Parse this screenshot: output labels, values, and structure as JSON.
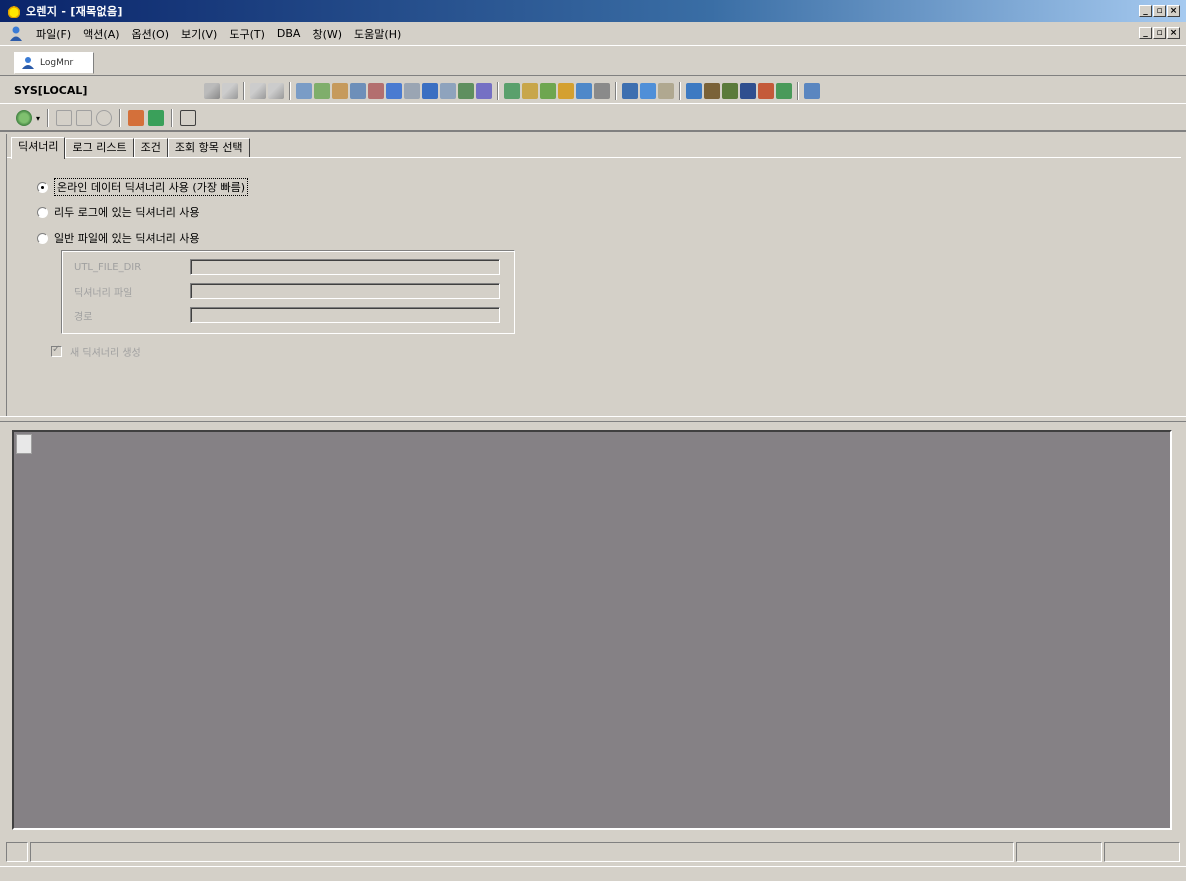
{
  "window": {
    "title": "오렌지 - [재목없음]",
    "controls": [
      "_",
      "▫",
      "×"
    ]
  },
  "menubar": {
    "items": [
      "파일(F)",
      "액션(A)",
      "옵션(O)",
      "보기(V)",
      "도구(T)",
      "DBA",
      "창(W)",
      "도움말(H)"
    ]
  },
  "doc_tab": {
    "label": "LogMnr"
  },
  "toolbar": {
    "connection": "SYS[LOCAL]"
  },
  "tabs": [
    "딕셔너리",
    "로그 리스트",
    "조건",
    "조회 항목 선택"
  ],
  "options": [
    {
      "label": "온라인 데이터 딕셔너리 사용 (가장 빠름)",
      "selected": true
    },
    {
      "label": "리두 로그에 있는 딕셔너리 사용",
      "selected": false
    },
    {
      "label": "일반 파일에 있는 딕셔너리 사용",
      "selected": false
    }
  ],
  "file_fields": [
    "UTL_FILE_DIR",
    "딕셔너리 파일",
    "경로"
  ],
  "checkbox": {
    "label": "새 딕셔너리 생성",
    "checked": true
  },
  "colors": {
    "titlebar_start": "#0a246a",
    "titlebar_end": "#a6caf0",
    "workspace": "#858185",
    "face": "#d4d0c8"
  }
}
